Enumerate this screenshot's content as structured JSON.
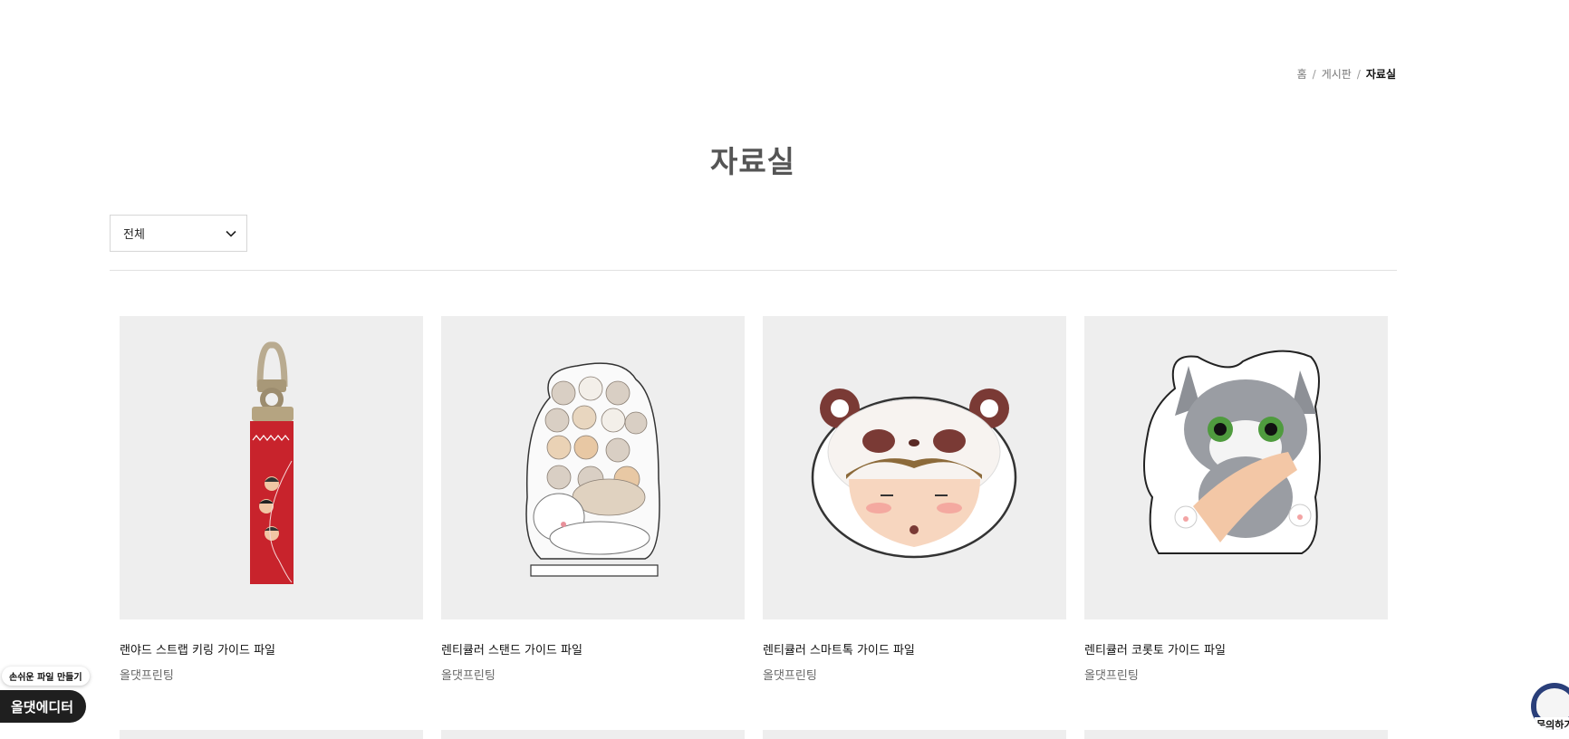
{
  "breadcrumb": {
    "home": "홈",
    "board": "게시판",
    "current": "자료실",
    "separator": "/"
  },
  "page_title": "자료실",
  "filter": {
    "selected": "전체"
  },
  "products": [
    {
      "title": "랜야드 스트랩 키링 가이드 파일",
      "author": "올댓프린팅",
      "icon": "lanyard-keyring-image"
    },
    {
      "title": "렌티큘러 스탠드 가이드 파일",
      "author": "올댓프린팅",
      "icon": "cat-stand-image"
    },
    {
      "title": "렌티큘러 스마트톡 가이드 파일",
      "author": "올댓프린팅",
      "icon": "panda-smarttok-image"
    },
    {
      "title": "렌티큘러 코롯토 가이드 파일",
      "author": "올댓프린팅",
      "icon": "gray-cat-korotto-image"
    }
  ],
  "editor_widget": {
    "tip": "손쉬운 파일 만들기",
    "button": "올댓에디터"
  },
  "inquiry": {
    "label": "문의하기"
  },
  "colors": {
    "thumb_bg": "#eeeeee",
    "lanyard_red": "#c8232c",
    "editor_bg": "#1f1f1f"
  }
}
